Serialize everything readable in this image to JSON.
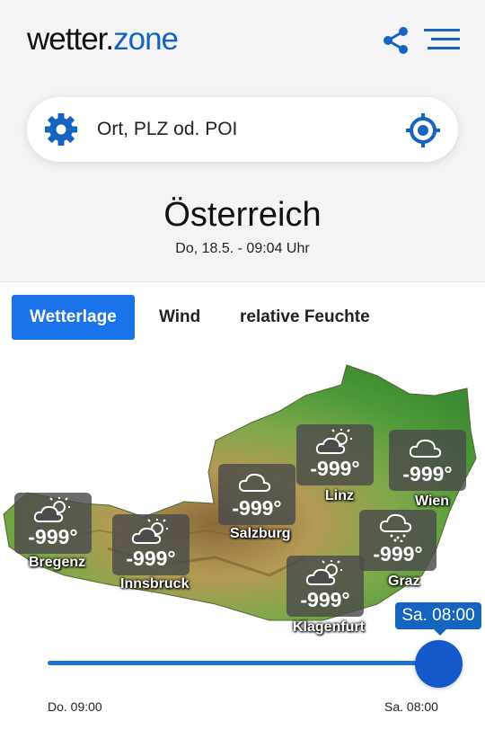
{
  "header": {
    "logo_part1": "wetter.",
    "logo_part2": "zone",
    "share_icon": "share-icon",
    "menu_icon": "hamburger-menu-icon"
  },
  "search": {
    "placeholder": "Ort, PLZ od. POI",
    "settings_icon": "gear-icon",
    "location_icon": "crosshair-location-icon"
  },
  "page": {
    "title": "Österreich",
    "subtitle": "Do, 18.5. - 09:04 Uhr"
  },
  "tabs": [
    {
      "label": "Wetterlage",
      "active": true
    },
    {
      "label": "Wind",
      "active": false
    },
    {
      "label": "relative Feuchte",
      "active": false
    }
  ],
  "cities": [
    {
      "name": "Bregenz",
      "temp": "-999°",
      "icon": "partly-cloudy-sun-icon"
    },
    {
      "name": "Innsbruck",
      "temp": "-999°",
      "icon": "partly-cloudy-sun-icon"
    },
    {
      "name": "Salzburg",
      "temp": "-999°",
      "icon": "cloud-icon"
    },
    {
      "name": "Linz",
      "temp": "-999°",
      "icon": "partly-cloudy-sun-icon"
    },
    {
      "name": "Wien",
      "temp": "-999°",
      "icon": "cloud-icon"
    },
    {
      "name": "Graz",
      "temp": "-999°",
      "icon": "cloud-snow-icon"
    },
    {
      "name": "Klagenfurt",
      "temp": "-999°",
      "icon": "partly-cloudy-sun-icon"
    }
  ],
  "timeline": {
    "current_label": "Sa. 08:00",
    "start_label": "Do. 09:00",
    "end_label": "Sa. 08:00",
    "position_fraction": 1.0
  },
  "colors": {
    "brand_blue": "#1565c0",
    "tab_active": "#1a73e8",
    "slider": "#1458c9"
  }
}
